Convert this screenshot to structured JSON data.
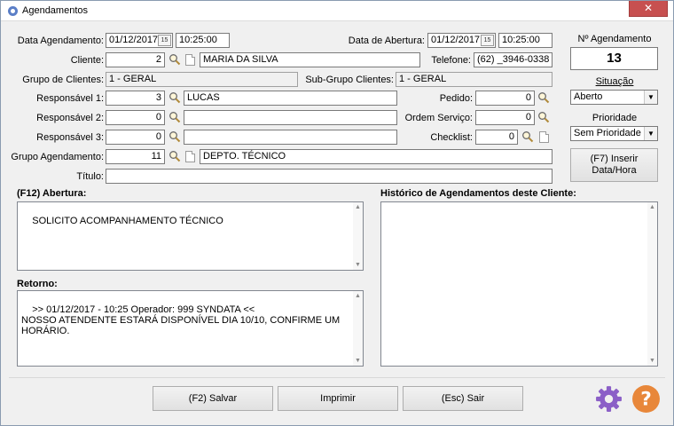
{
  "window": {
    "title": "Agendamentos",
    "close_glyph": "✕"
  },
  "form": {
    "data_agendamento_label": "Data Agendamento:",
    "data_agendamento": "01/12/2017",
    "hora_agendamento": "10:25:00",
    "data_abertura_label": "Data de Abertura:",
    "data_abertura": "01/12/2017",
    "hora_abertura": "10:25:00",
    "calendar_glyph": "15",
    "cliente_label": "Cliente:",
    "cliente_code": "2",
    "cliente_name": "MARIA DA SILVA",
    "telefone_label": "Telefone:",
    "telefone": "(62) _3946-0338",
    "grupo_clientes_label": "Grupo de Clientes:",
    "grupo_clientes": "1 - GERAL",
    "subgrupo_label": "Sub-Grupo Clientes:",
    "subgrupo": "1 - GERAL",
    "resp1_label": "Responsável 1:",
    "resp1_code": "3",
    "resp1_name": "LUCAS",
    "resp2_label": "Responsável 2:",
    "resp2_code": "0",
    "resp2_name": "",
    "resp3_label": "Responsável 3:",
    "resp3_code": "0",
    "resp3_name": "",
    "pedido_label": "Pedido:",
    "pedido": "0",
    "ordem_label": "Ordem Serviço:",
    "ordem": "0",
    "checklist_label": "Checklist:",
    "checklist": "0",
    "grupo_agend_label": "Grupo Agendamento:",
    "grupo_agend_code": "11",
    "grupo_agend_name": "DEPTO. TÉCNICO",
    "titulo_label": "Título:",
    "titulo": ""
  },
  "side": {
    "numero_label": "Nº Agendamento",
    "numero": "13",
    "situacao_label": "Situação",
    "situacao": "Aberto",
    "prioridade_label": "Prioridade",
    "prioridade": "Sem Prioridade",
    "inserir_button": "(F7) Inserir\nData/Hora"
  },
  "abertura": {
    "label": "(F12) Abertura:",
    "text": "SOLICITO ACOMPANHAMENTO TÉCNICO"
  },
  "historico": {
    "label": "Histórico de Agendamentos deste Cliente:"
  },
  "retorno": {
    "label": "Retorno:",
    "text": ">> 01/12/2017 - 10:25 Operador: 999 SYNDATA <<\nNOSSO ATENDENTE ESTARÁ DISPONÍVEL DIA 10/10, CONFIRME UM HORÁRIO."
  },
  "footer": {
    "salvar": "(F2) Salvar",
    "imprimir": "Imprimir",
    "sair": "(Esc) Sair"
  },
  "colors": {
    "settings_icon": "#8b5fc7",
    "help_icon": "#e8873a"
  },
  "icons": [
    "magnifier-icon",
    "document-icon",
    "calendar-icon",
    "settings-icon",
    "help-icon"
  ]
}
